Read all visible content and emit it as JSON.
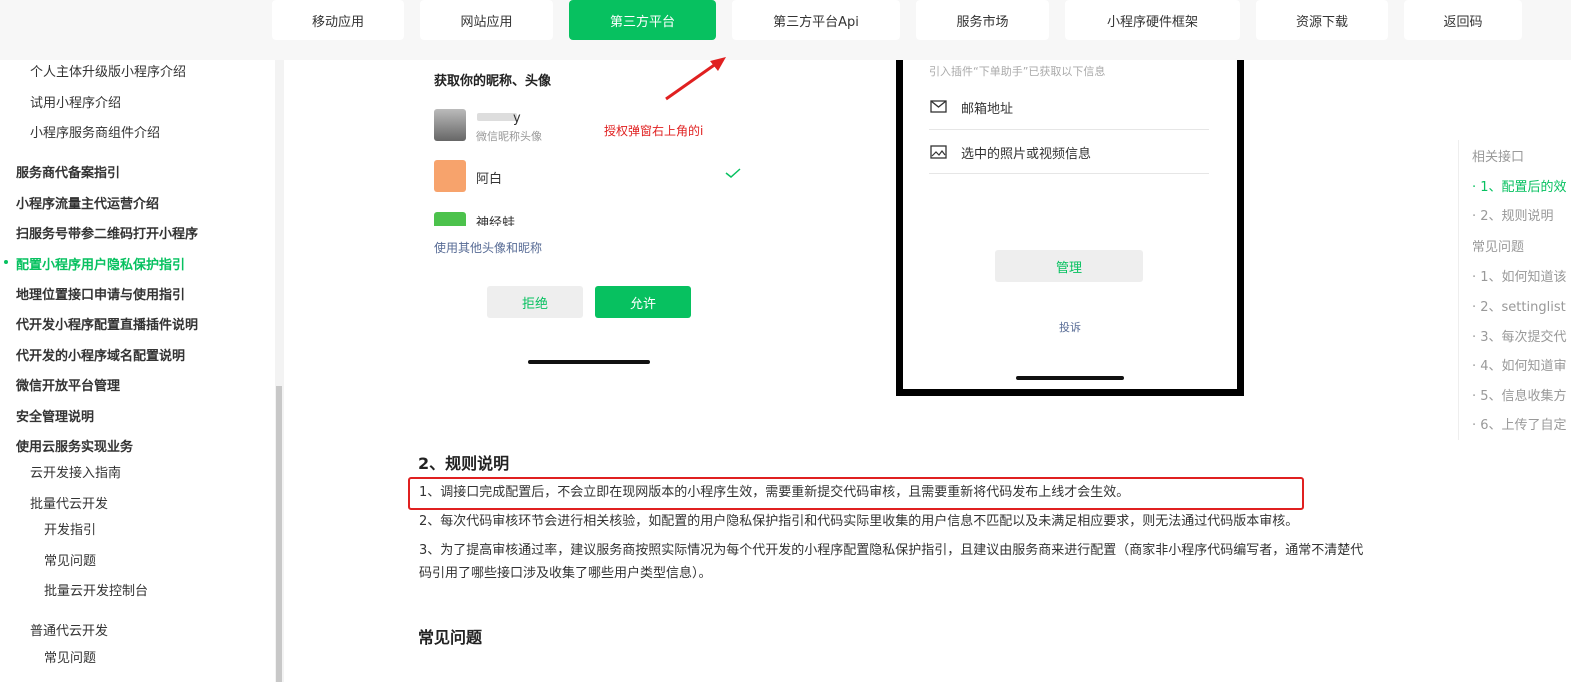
{
  "nav": {
    "items": [
      "移动应用",
      "网站应用",
      "第三方平台",
      "第三方平台Api",
      "服务市场",
      "小程序硬件框架",
      "资源下载",
      "返回码"
    ],
    "active": "第三方平台"
  },
  "sidebar": {
    "items": [
      "个人主体升级版小程序介绍",
      "试用小程序介绍",
      "小程序服务商组件介绍",
      "服务商代备案指引",
      "小程序流量主代运营介绍",
      "扫服务号带参二维码打开小程序",
      "配置小程序用户隐私保护指引",
      "地理位置接口申请与使用指引",
      "代开发小程序配置直播插件说明",
      "代开发的小程序域名配置说明",
      "微信开放平台管理",
      "安全管理说明",
      "使用云服务实现业务",
      "云开发接入指南",
      "批量代云开发",
      "开发指引",
      "常见问题",
      "批量云开发控制台",
      "普通代云开发",
      "常见问题"
    ]
  },
  "mock1": {
    "title": "获取你的昵称、头像",
    "name1": "y",
    "name1_sub": "微信昵称头像",
    "name2": "阿白",
    "name3": "神经蛙",
    "other": "使用其他头像和昵称",
    "reject": "拒绝",
    "allow": "允许",
    "annotation": "授权弹窗右上角的i"
  },
  "mock2": {
    "intro": "引入插件“下单助手”已获取以下信息",
    "item1": "邮箱地址",
    "item2": "选中的照片或视频信息",
    "manage": "管理",
    "complain": "投诉"
  },
  "article": {
    "section2_title": "2、规则说明",
    "p1": "1、调接口完成配置后，不会立即在现网版本的小程序生效，需要重新提交代码审核，且需要重新将代码发布上线才会生效。",
    "p2": "2、每次代码审核环节会进行相关核验，如配置的用户隐私保护指引和代码实际里收集的用户信息不匹配以及未满足相应要求，则无法通过代码版本审核。",
    "p3": "3、为了提高审核通过率，建议服务商按照实际情况为每个代开发的小程序配置隐私保护指引，且建议由服务商来进行配置（商家非小程序代码编写者，通常不清楚代码引用了哪些接口涉及收集了哪些用户类型信息）。",
    "faq_title": "常见问题"
  },
  "toc": {
    "items": [
      "相关接口",
      "· 1、配置后的效",
      "· 2、规则说明",
      "常见问题",
      "· 1、如何知道该",
      "· 2、settinglist",
      "· 3、每次提交代",
      "· 4、如何知道审",
      "· 5、信息收集方",
      "· 6、上传了自定"
    ]
  },
  "colors": {
    "accent": "#07c160",
    "highlight_box": "#e02020",
    "annotation": "#e02020"
  }
}
